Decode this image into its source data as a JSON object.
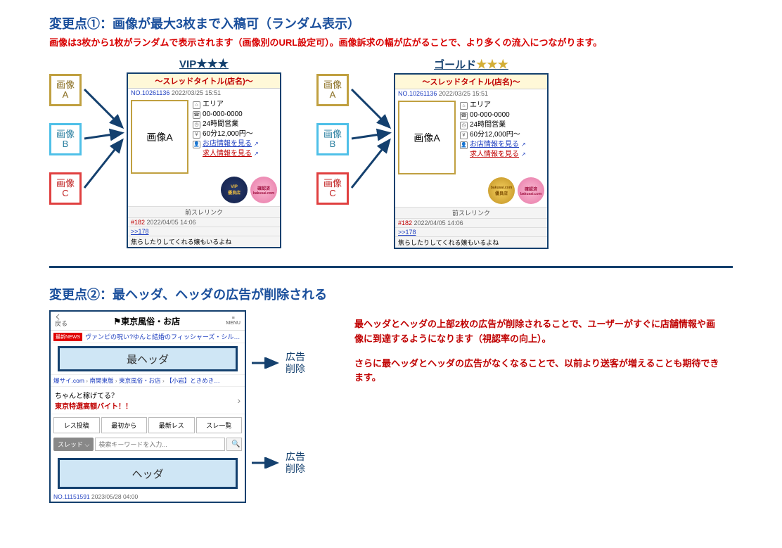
{
  "section1": {
    "title": "変更点①：画像が最大3枚まで入稿可（ランダム表示）",
    "subtitle": "画像は3枚から1枚がランダムで表示されます（画像別のURL設定可）。画像訴求の幅が広がることで、より多くの流入につながります。",
    "tags": {
      "a": "画像\nA",
      "b": "画像\nB",
      "c": "画像\nC"
    },
    "plan_vip": "VIP",
    "plan_gold": "ゴールド",
    "stars": "★★★",
    "card": {
      "thread_title": "～スレッドタイトル(店名)～",
      "no": "NO.10261136",
      "ts": "2022/03/25 15:51",
      "img_label": "画像A",
      "area": "エリア",
      "tel": "00-000-0000",
      "hours": "24時間営業",
      "price": "60分12,000円～",
      "shop_link": "お店情報を見る",
      "recruit_link": "求人情報を見る",
      "badge_vip_1": "VIP",
      "badge_vip_2": "優良店",
      "badge_gold": "優良店",
      "badge_pink": "確認済",
      "badge_src": "bakusai.com",
      "prev": "前スレリンク",
      "prev_id": "#182",
      "prev_ts": "2022/04/05 14:06",
      "reply_link": ">>178",
      "reply_txt": "焦らしたりしてくれる嬢もいるよね"
    }
  },
  "section2": {
    "title": "変更点②：最ヘッダ、ヘッダの広告が削除される",
    "arrow_label": "広告\n削除",
    "desc_p1": "最ヘッダとヘッダの上部2枚の広告が削除されることで、ユーザーがすぐに店舗情報や画像に到達するようになります（視認率の向上）。",
    "desc_p2": "さらに最ヘッダとヘッダの広告がなくなることで、以前より送客が増えることも期待できます。",
    "phone": {
      "back": "く\n戻る",
      "logo": "⚑東京風俗・お店",
      "menu": "≡\nMENU",
      "news_tag": "最新NEWS",
      "news_txt": "ヴァンピの呪い?ゆんと結婚のフィッシャーズ・シル…",
      "ad1": "最ヘッダ",
      "crumbs": [
        "爆サイ.com",
        "南関東版",
        "東京風俗・お店",
        "【小岩】ときめき…"
      ],
      "promo1": "ちゃんと稼げてる？",
      "promo2": "東京特選高額バイト！！",
      "btns": [
        "レス投稿",
        "最初から",
        "最新レス",
        "スレ一覧"
      ],
      "sel": "スレッド ⌵",
      "placeholder": "検索キーワードを入力...",
      "ad2": "ヘッダ",
      "foot_no": "NO.11151591",
      "foot_ts": "2023/05/28 04:00"
    }
  }
}
